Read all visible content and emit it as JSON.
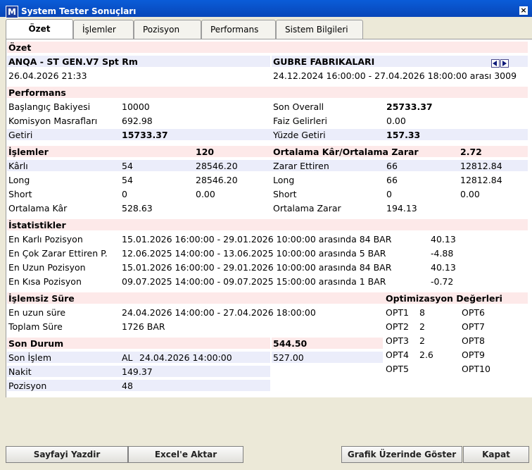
{
  "window": {
    "logo_letter": "M",
    "title": "System Tester Sonuçları",
    "close_glyph": "×"
  },
  "tabs": [
    {
      "label": "Özet"
    },
    {
      "label": "İşlemler"
    },
    {
      "label": "Pozisyon"
    },
    {
      "label": "Performans"
    },
    {
      "label": "Sistem Bilgileri"
    }
  ],
  "summary": {
    "header": "Özet",
    "system_name": "ANQA - ST GEN.V7 Spt Rm",
    "datetime": "26.04.2026 21:33",
    "symbol": "GUBRE FABRIKALARI",
    "range": "24.12.2024 16:00:00 - 27.04.2026 18:00:00 arası 3009"
  },
  "performance": {
    "header": "Performans",
    "start_balance_label": "Başlangıç Bakiyesi",
    "start_balance": "10000",
    "commission_label": "Komisyon Masrafları",
    "commission": "692.98",
    "return_label": "Getiri",
    "return": "15733.37",
    "overall_label": "Son Overall",
    "overall": "25733.37",
    "interest_label": "Faiz Gelirleri",
    "interest": "0.00",
    "pct_label": "Yüzde Getiri",
    "pct": "157.33"
  },
  "trades": {
    "header": "İşlemler",
    "count": "120",
    "profitable_label": "Kârlı",
    "profitable_count": "54",
    "profitable_value": "28546.20",
    "long_label": "Long",
    "long_count": "54",
    "long_value": "28546.20",
    "short_label": "Short",
    "short_count": "0",
    "short_value": "0.00",
    "avg_profit_label": "Ortalama Kâr",
    "avg_profit": "528.63",
    "ratio_label": "Ortalama Kâr/Ortalama Zarar",
    "ratio": "2.72",
    "losing_label": "Zarar Ettiren",
    "losing_count": "66",
    "losing_value": "12812.84",
    "long2_label": "Long",
    "long2_count": "66",
    "long2_value": "12812.84",
    "short2_label": "Short",
    "short2_count": "0",
    "short2_value": "0.00",
    "avg_loss_label": "Ortalama Zarar",
    "avg_loss": "194.13"
  },
  "stats": {
    "header": "İstatistikler",
    "rows": [
      {
        "label": "En Karlı Pozisyon",
        "range": "15.01.2026 16:00:00 - 29.01.2026 10:00:00 arasında 84 BAR",
        "value": "40.13"
      },
      {
        "label": "En Çok Zarar Ettiren P.",
        "range": "12.06.2025 14:00:00 - 13.06.2025 10:00:00 arasında 5 BAR",
        "value": "-4.88"
      },
      {
        "label": "En Uzun Pozisyon",
        "range": "15.01.2026 16:00:00 - 29.01.2026 10:00:00 arasında 84 BAR",
        "value": "40.13"
      },
      {
        "label": "En Kısa Pozisyon",
        "range": "09.07.2025 14:00:00 - 09.07.2025 15:00:00 arasında 1 BAR",
        "value": "-0.72"
      }
    ]
  },
  "idle": {
    "header": "İşlemsiz Süre",
    "longest_label": "En uzun süre",
    "longest": "24.04.2026 14:00:00 - 27.04.2026 18:00:00",
    "total_label": "Toplam Süre",
    "total": "1726 BAR"
  },
  "last": {
    "header": "Son Durum",
    "header_value": "544.50",
    "trade_label": "Son İşlem",
    "trade_action": "AL",
    "trade_time": "24.04.2026 14:00:00",
    "trade_price": "527.00",
    "cash_label": "Nakit",
    "cash": "149.37",
    "position_label": "Pozisyon",
    "position": "48"
  },
  "optimization": {
    "header": "Optimizasyon Değerleri",
    "left": [
      {
        "label": "OPT1",
        "value": "8"
      },
      {
        "label": "OPT2",
        "value": "2"
      },
      {
        "label": "OPT3",
        "value": "2"
      },
      {
        "label": "OPT4",
        "value": "2.6"
      },
      {
        "label": "OPT5",
        "value": ""
      }
    ],
    "right": [
      {
        "label": "OPT6"
      },
      {
        "label": "OPT7"
      },
      {
        "label": "OPT8"
      },
      {
        "label": "OPT9"
      },
      {
        "label": "OPT10"
      }
    ]
  },
  "buttons": {
    "print": "Sayfayi Yazdir",
    "excel": "Excel'e Aktar",
    "chart": "Grafik Üzerinde Göster",
    "close": "Kapat"
  }
}
